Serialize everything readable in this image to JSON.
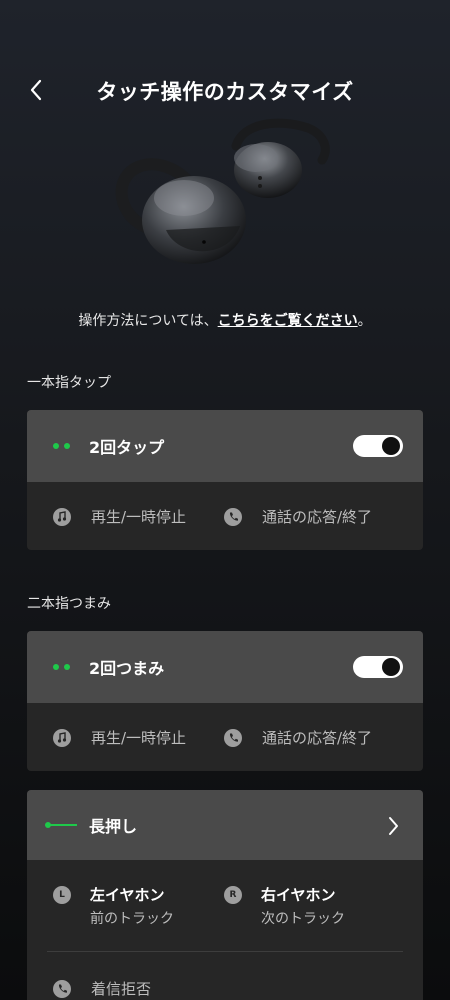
{
  "header": {
    "title": "タッチ操作のカスタマイズ"
  },
  "info": {
    "prefix": "操作方法については、",
    "link": "こちらをご覧ください",
    "suffix": "。"
  },
  "single_tap": {
    "section_label": "一本指タップ",
    "name": "2回タップ",
    "enabled": true,
    "actions": [
      {
        "icon": "music-note-icon",
        "label": "再生/一時停止"
      },
      {
        "icon": "phone-call-icon",
        "label": "通話の応答/終了"
      }
    ]
  },
  "pinch": {
    "section_label": "二本指つまみ",
    "name": "2回つまみ",
    "enabled": true,
    "actions": [
      {
        "icon": "music-note-icon",
        "label": "再生/一時停止"
      },
      {
        "icon": "phone-call-icon",
        "label": "通話の応答/終了"
      }
    ]
  },
  "long_press": {
    "name": "長押し",
    "left": {
      "badge": "L",
      "title": "左イヤホン",
      "action": "前のトラック"
    },
    "right": {
      "badge": "R",
      "title": "右イヤホン",
      "action": "次のトラック"
    },
    "extra": {
      "icon": "phone-reject-icon",
      "label": "着信拒否"
    }
  },
  "colors": {
    "accent_green": "#1ec94a",
    "card_header": "#4a4a4a",
    "card_body": "#262626"
  }
}
